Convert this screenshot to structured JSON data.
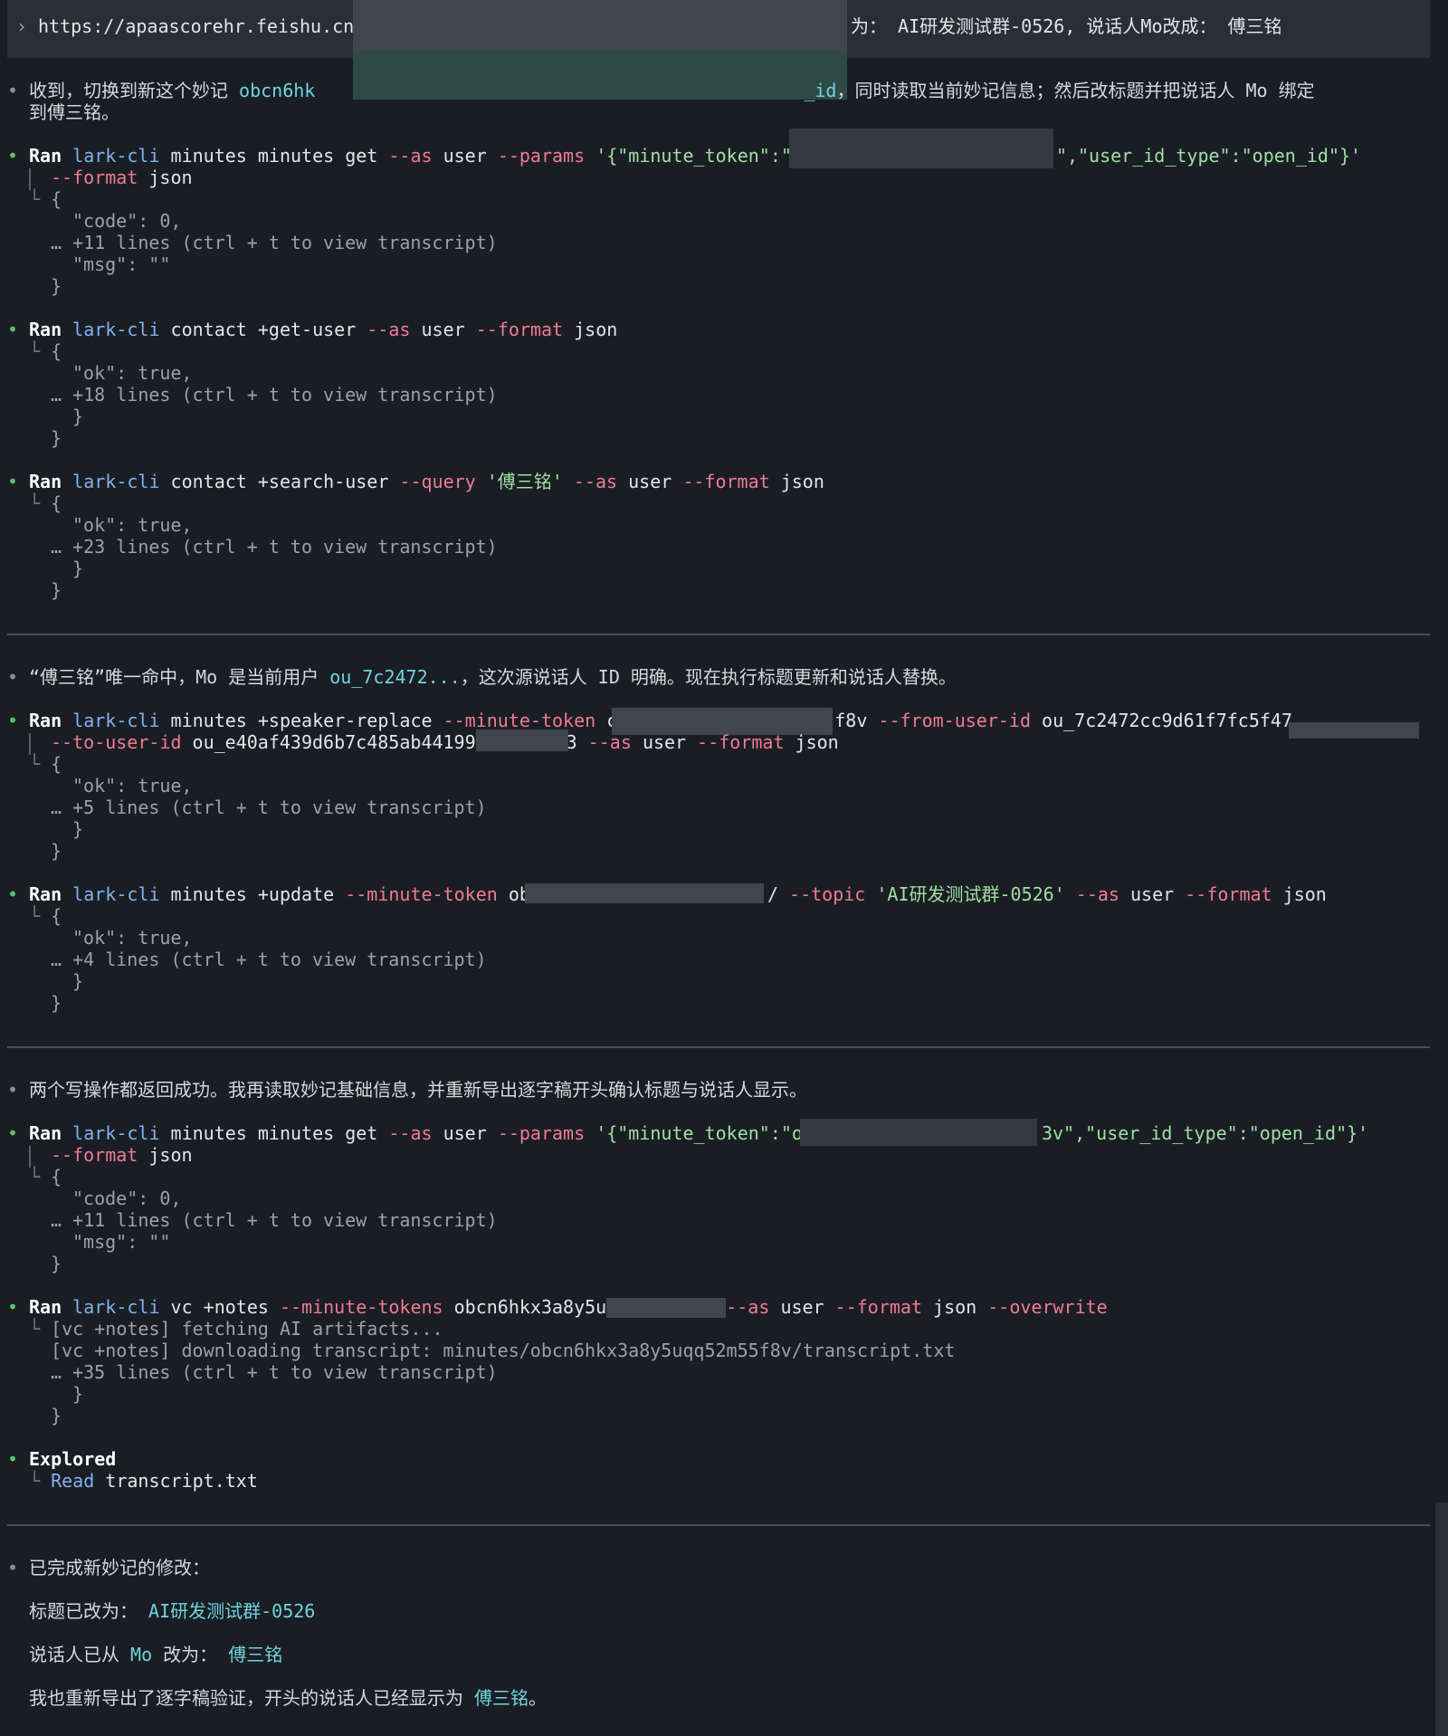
{
  "prompt": {
    "url": "https://apaascorehr.feishu.cn/",
    "tail": "为： AI研发测试群-0526, 说话人Mo改成： 傅三铭"
  },
  "msg1": {
    "a": "收到，切换到新这个妙记 ",
    "token": "obcn6hk",
    "b": "_id",
    "c": "，同时读取当前妙记信息；然后改标题并把说话人 Mo 绑定",
    "d": "到傅三铭。"
  },
  "common": {
    "ran": "Ran",
    "cli": "lark-cli",
    "as": "--as",
    "user": "user",
    "format": "--format",
    "json": "json",
    "brace_open": "{",
    "brace_close": "}"
  },
  "cmd1": {
    "sub": "minutes minutes get",
    "params": "--params",
    "arg_a": "'{\"minute_token\":\"",
    "arg_b": "\",\"user_id_type\":\"open_id\"}'",
    "out1": "\"code\": 0,",
    "more": "… +11 lines (ctrl + t to view transcript)",
    "out2": "\"msg\": \"\""
  },
  "cmd2": {
    "sub": "contact +get-user",
    "out1": "\"ok\": true,",
    "more": "… +18 lines (ctrl + t to view transcript)"
  },
  "cmd3": {
    "sub": "contact +search-user",
    "query": "--query",
    "qval": "'傅三铭'",
    "out1": "\"ok\": true,",
    "more": "… +23 lines (ctrl + t to view transcript)"
  },
  "msg2": {
    "a": "“傅三铭”唯一命中，Mo 是当前用户 ",
    "id": "ou_7c2472...",
    "b": "，这次源说话人 ID 明确。现在执行标题更新和说话人替换。"
  },
  "cmd4": {
    "sub": "minutes +speaker-replace",
    "mt": "--minute-token",
    "mtv_a": "c",
    "mtv_b": "f8v",
    "from": "--from-user-id",
    "fromv": "ou_7c2472cc9d61f7fc5f47",
    "to": "--to-user-id",
    "tov_a": "ou_e40af439d6b7c485ab44199",
    "tov_b": "3",
    "out1": "\"ok\": true,",
    "more": "… +5 lines (ctrl + t to view transcript)"
  },
  "cmd5": {
    "sub": "minutes +update",
    "mt": "--minute-token",
    "mtv_a": "ob",
    "mtv_b": "/",
    "topic": "--topic",
    "topicv": "'AI研发测试群-0526'",
    "out1": "\"ok\": true,",
    "more": "… +4 lines (ctrl + t to view transcript)"
  },
  "msg3": {
    "a": "两个写操作都返回成功。我再读取妙记基础信息，并重新导出逐字稿开头确认标题与说话人显示。"
  },
  "cmd6": {
    "sub": "minutes minutes get",
    "params": "--params",
    "arg_a": "'{\"minute_token\":\"o",
    "arg_b": "3v\",\"user_id_type\":\"open_id\"}'",
    "out1": "\"code\": 0,",
    "more": "… +11 lines (ctrl + t to view transcript)",
    "out2": "\"msg\": \"\""
  },
  "cmd7": {
    "sub": "vc +notes",
    "mts": "--minute-tokens",
    "mtsv": "obcn6hkx3a8y5u",
    "as_flag": "--as",
    "overwrite": "--overwrite",
    "out1": "[vc +notes] fetching AI artifacts...",
    "out2": "[vc +notes] downloading transcript: minutes/obcn6hkx3a8y5uqq52m55f8v/transcript.txt",
    "more": "… +35 lines (ctrl + t to view transcript)"
  },
  "explored": {
    "title": "Explored",
    "read": "Read",
    "file": "transcript.txt"
  },
  "final": {
    "head": "已完成新妙记的修改：",
    "title_label": "标题已改为：",
    "title_val": "AI研发测试群-0526",
    "spk_a": "说话人已从 ",
    "spk_from": "Mo",
    "spk_b": " 改为：",
    "spk_to": "傅三铭",
    "verify_a": "我也重新导出了逐字稿验证，开头的说话人已经显示为 ",
    "verify_name": "傅三铭",
    "verify_b": "。"
  },
  "glyphs": {
    "bullet": "•",
    "chevron": "›",
    "corner": "└"
  },
  "colors": {
    "background": "#1a1e24",
    "bullet_green": "#56c26a",
    "command": "#7fb1f0",
    "flag": "#f07a93",
    "string": "#9de0a0",
    "accent": "#6fd4e0"
  }
}
